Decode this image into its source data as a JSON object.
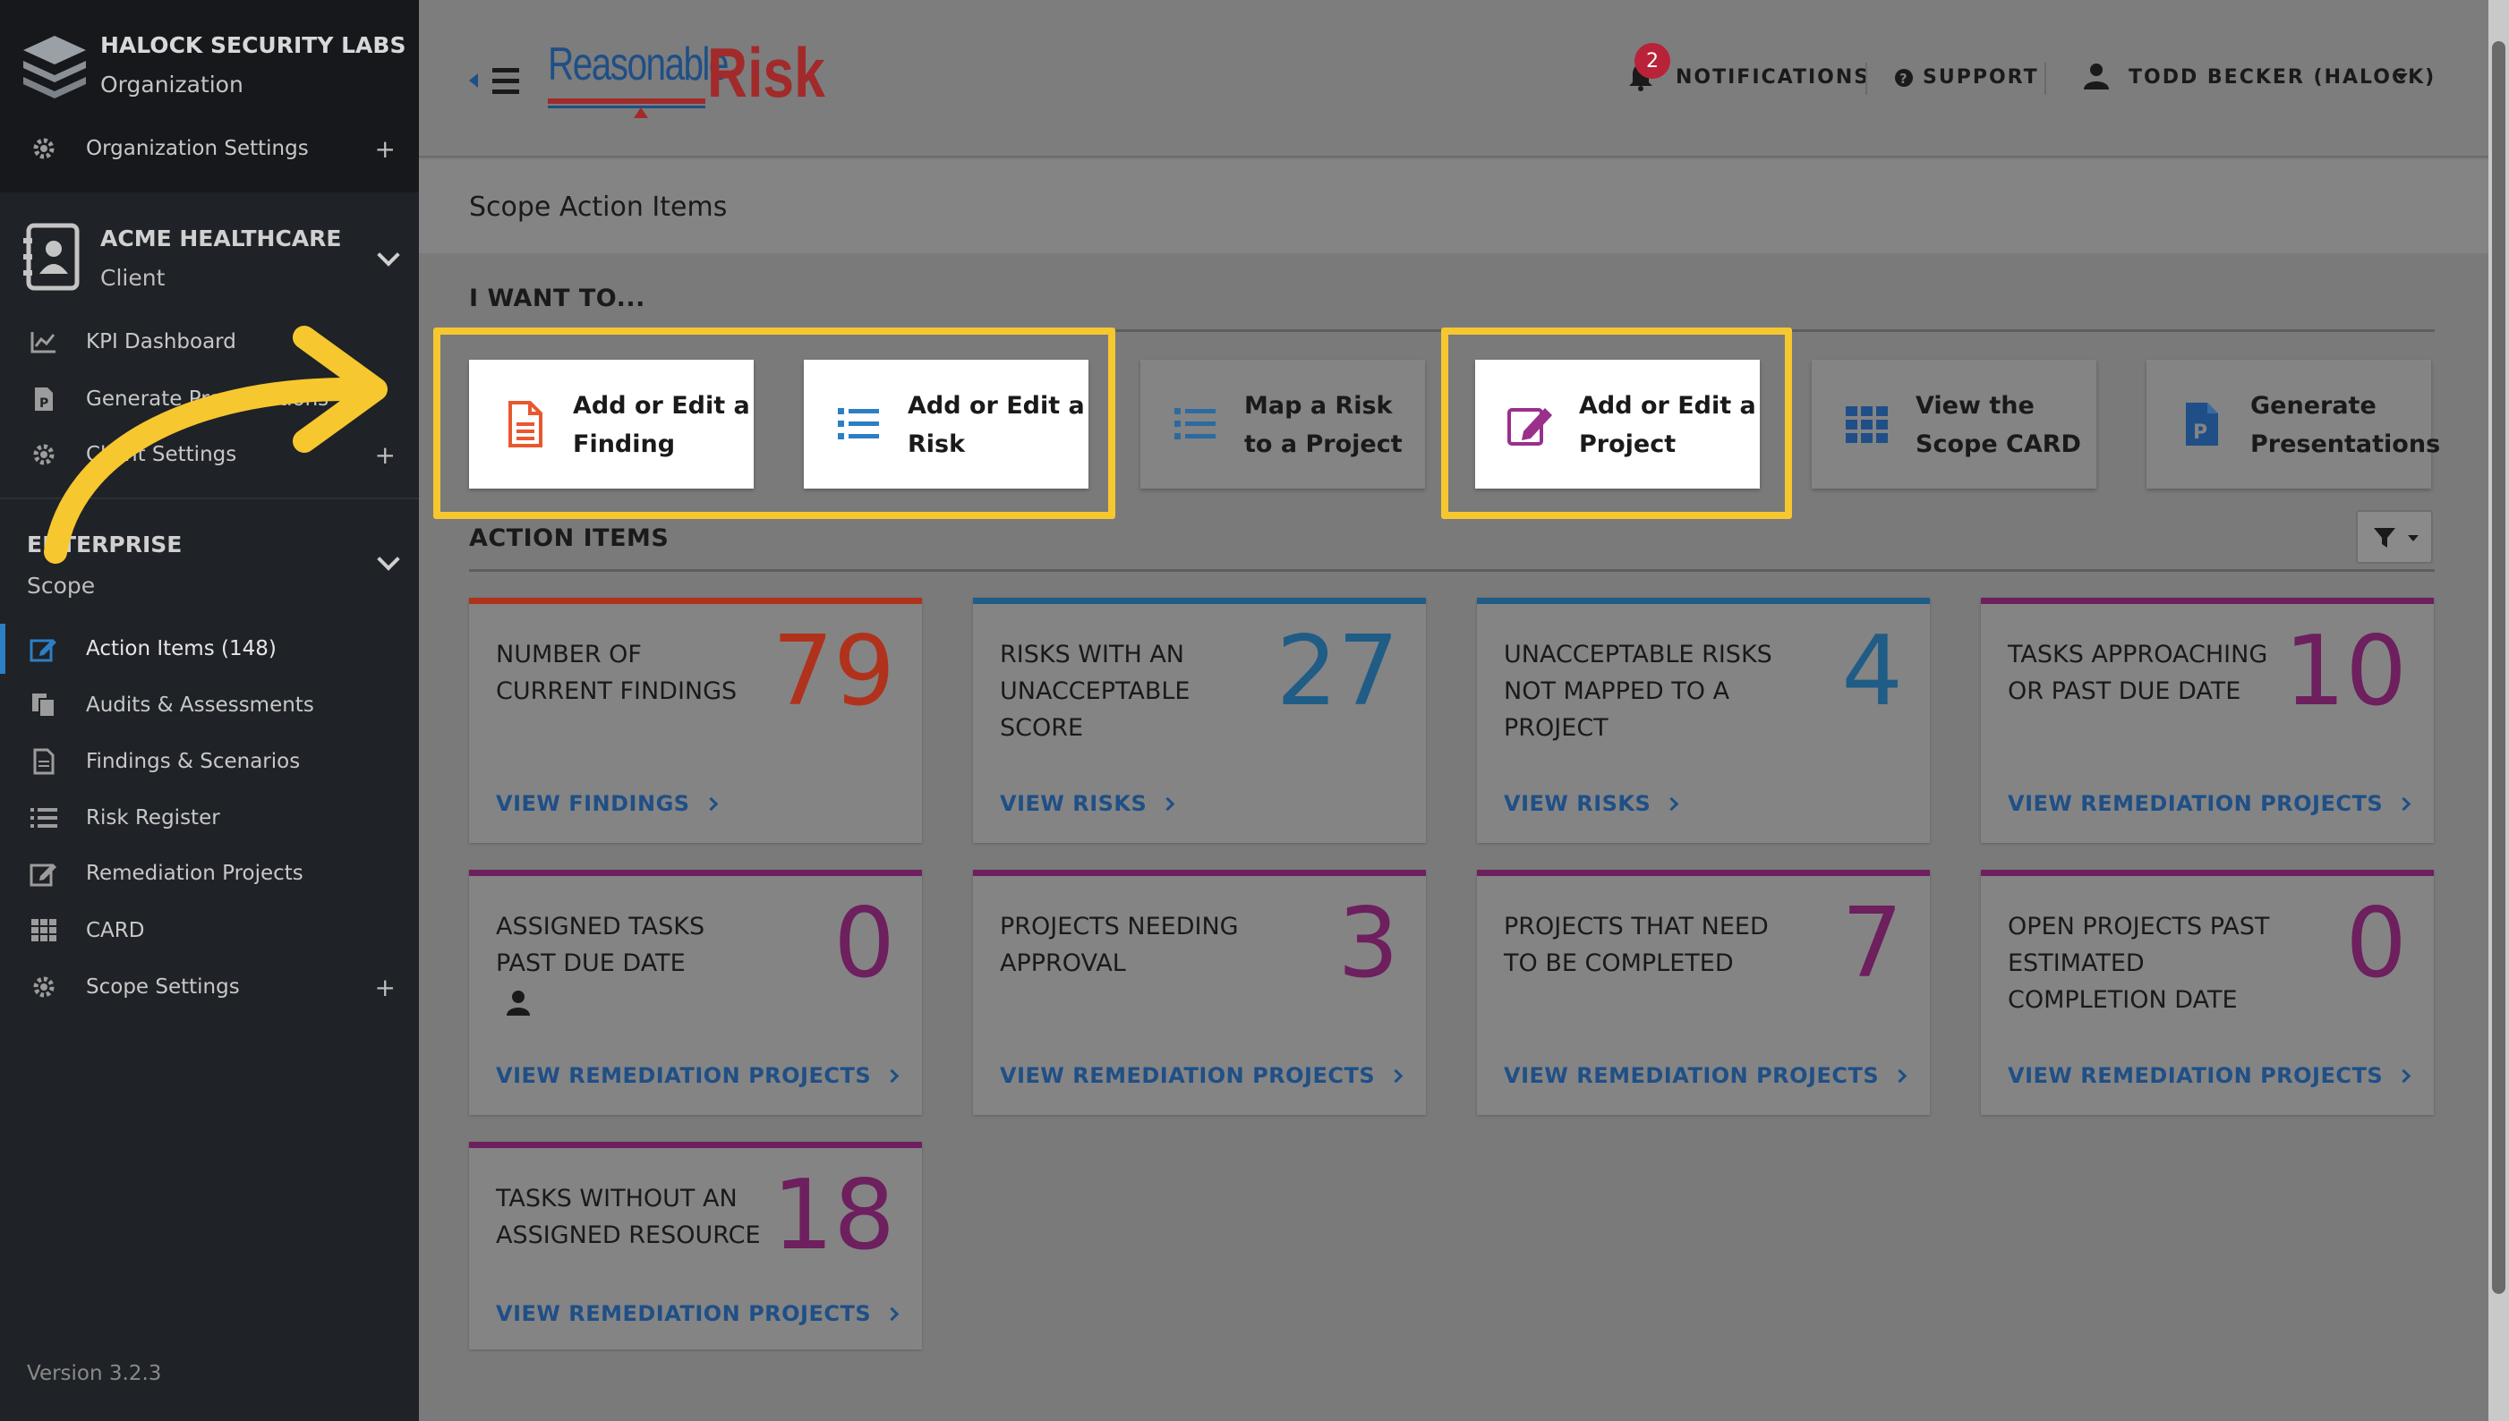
{
  "sidebar": {
    "org": {
      "name": "HALOCK SECURITY LABS",
      "type": "Organization",
      "settings": "Organization Settings"
    },
    "client": {
      "name": "ACME HEALTHCARE",
      "type": "Client",
      "items": [
        "KPI Dashboard",
        "Generate Presentations",
        "Client Settings"
      ]
    },
    "scope": {
      "name": "ENTERPRISE",
      "type": "Scope",
      "items": [
        "Action Items (148)",
        "Audits & Assessments",
        "Findings & Scenarios",
        "Risk Register",
        "Remediation Projects",
        "CARD",
        "Scope Settings"
      ]
    },
    "version": "Version 3.2.3"
  },
  "header": {
    "brand_left": "Reasonable",
    "brand_right": "Risk",
    "notifications": "NOTIFICATIONS",
    "notification_count": "2",
    "support": "SUPPORT",
    "user": "TODD BECKER (HALOCK)"
  },
  "page": {
    "title": "Scope Action Items",
    "i_want_to": "I WANT TO...",
    "action_items_heading": "ACTION ITEMS"
  },
  "quick_actions": [
    {
      "label": "Add or Edit a Finding",
      "highlighted": true,
      "color": "#e8582f"
    },
    {
      "label": "Add or Edit a Risk",
      "highlighted": true,
      "color": "#2c7fc4"
    },
    {
      "label": "Map a Risk to a Project",
      "highlighted": false,
      "color": "#2c6aa0"
    },
    {
      "label": "Add or Edit a Project",
      "highlighted": true,
      "color": "#9b2f8c"
    },
    {
      "label": "View the Scope CARD",
      "highlighted": false,
      "color": "#1f4f86"
    },
    {
      "label": "Generate Presentations",
      "highlighted": false,
      "color": "#1f4f86"
    }
  ],
  "cards": [
    {
      "text": "NUMBER OF CURRENT FINDINGS",
      "value": "79",
      "link": "VIEW FINDINGS",
      "color": "#b0321c"
    },
    {
      "text": "RISKS WITH AN UNACCEPTABLE SCORE",
      "value": "27",
      "link": "VIEW RISKS",
      "color": "#1f5c86"
    },
    {
      "text": "UNACCEPTABLE RISKS NOT MAPPED TO A PROJECT",
      "value": "4",
      "link": "VIEW RISKS",
      "color": "#1f5c86"
    },
    {
      "text": "TASKS APPROACHING OR PAST DUE DATE",
      "value": "10",
      "link": "VIEW REMEDIATION PROJECTS",
      "color": "#6d1f5e"
    },
    {
      "text": "ASSIGNED TASKS PAST DUE DATE",
      "value": "0",
      "link": "VIEW REMEDIATION PROJECTS",
      "color": "#6d1f5e",
      "user_icon": true
    },
    {
      "text": "PROJECTS NEEDING APPROVAL",
      "value": "3",
      "link": "VIEW REMEDIATION PROJECTS",
      "color": "#6d1f5e"
    },
    {
      "text": "PROJECTS THAT NEED TO BE COMPLETED",
      "value": "7",
      "link": "VIEW REMEDIATION PROJECTS",
      "color": "#6d1f5e"
    },
    {
      "text": "OPEN PROJECTS PAST ESTIMATED COMPLETION DATE",
      "value": "0",
      "link": "VIEW REMEDIATION PROJECTS",
      "color": "#6d1f5e"
    },
    {
      "text": "TASKS WITHOUT AN ASSIGNED RESOURCE",
      "value": "18",
      "link": "VIEW REMEDIATION PROJECTS",
      "color": "#6d1f5e"
    }
  ],
  "colors": {
    "highlight": "#f6c72f",
    "sidebar_bg": "#1f2226",
    "accent_blue": "#2c7fc4"
  }
}
